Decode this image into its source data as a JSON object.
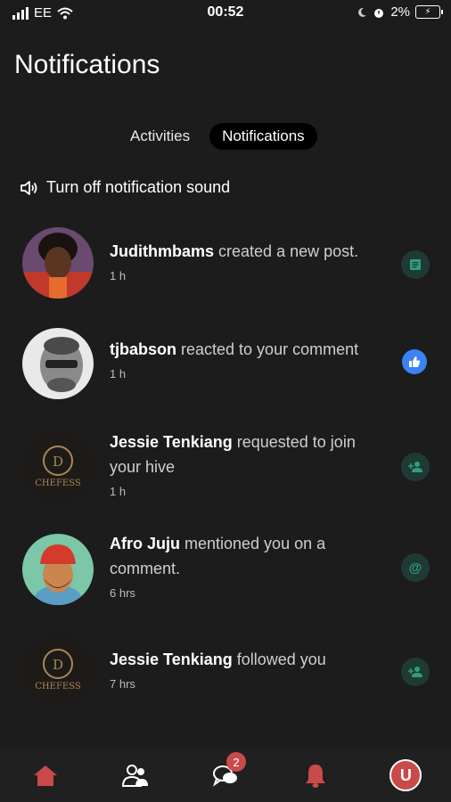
{
  "status_bar": {
    "carrier": "EE",
    "time": "00:52",
    "battery": "2%"
  },
  "page": {
    "title": "Notifications"
  },
  "tabs": [
    {
      "label": "Activities",
      "active": false
    },
    {
      "label": "Notifications",
      "active": true
    }
  ],
  "sound_toggle": {
    "label": "Turn off notification sound",
    "icon": "speaker-icon"
  },
  "notifications": [
    {
      "user": "Judithmbams",
      "text": " created a new post.",
      "time": "1 h",
      "type_icon": "post-icon"
    },
    {
      "user": "tjbabson",
      "text": " reacted to your comment",
      "time": "1 h",
      "type_icon": "thumbs-up-icon"
    },
    {
      "user": "Jessie Tenkiang",
      "text": " requested to join your hive",
      "time": "1 h",
      "type_icon": "add-user-icon"
    },
    {
      "user": "Afro Juju",
      "text": " mentioned you on a comment.",
      "time": "6 hrs",
      "type_icon": "mention-icon"
    },
    {
      "user": "Jessie Tenkiang",
      "text": " followed you",
      "time": "7 hrs",
      "type_icon": "add-user-icon"
    }
  ],
  "avatar_brand_text": "CHEFESS",
  "bottom_nav": {
    "messages_badge": "2",
    "profile_letter": "U"
  },
  "colors": {
    "accent_red": "#c94a4a",
    "teal_icon": "#2e9e7e",
    "like_blue": "#3b82f6",
    "background": "#1c1c1c"
  }
}
